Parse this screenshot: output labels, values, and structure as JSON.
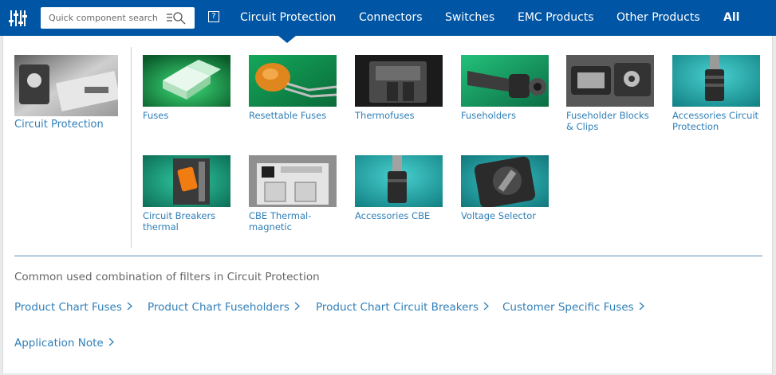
{
  "nav": {
    "search_placeholder": "Quick component search",
    "help_label": "?",
    "items": [
      {
        "label": "Circuit Protection"
      },
      {
        "label": "Connectors"
      },
      {
        "label": "Switches"
      },
      {
        "label": "EMC Products"
      },
      {
        "label": "Other Products"
      },
      {
        "label": "All"
      }
    ]
  },
  "category": {
    "label": "Circuit Protection"
  },
  "tiles": [
    {
      "label": "Fuses"
    },
    {
      "label": "Resettable Fuses"
    },
    {
      "label": "Thermofuses"
    },
    {
      "label": "Fuseholders"
    },
    {
      "label": "Fuseholder Blocks & Clips"
    },
    {
      "label": "Accessories Circuit Protection"
    },
    {
      "label": "Circuit Breakers thermal"
    },
    {
      "label": "CBE Thermal-magnetic"
    },
    {
      "label": "Accessories CBE"
    },
    {
      "label": "Voltage Selector"
    }
  ],
  "filters": {
    "title": "Common used combination of filters in Circuit Protection",
    "links": [
      {
        "label": "Product Chart Fuses"
      },
      {
        "label": "Product Chart Fuseholders"
      },
      {
        "label": "Product Chart Circuit Breakers"
      },
      {
        "label": "Customer Specific Fuses"
      },
      {
        "label": "Application Note"
      }
    ]
  },
  "colors": {
    "nav_bg": "#0055a4",
    "link": "#2f7fb8",
    "text_muted": "#666666"
  }
}
